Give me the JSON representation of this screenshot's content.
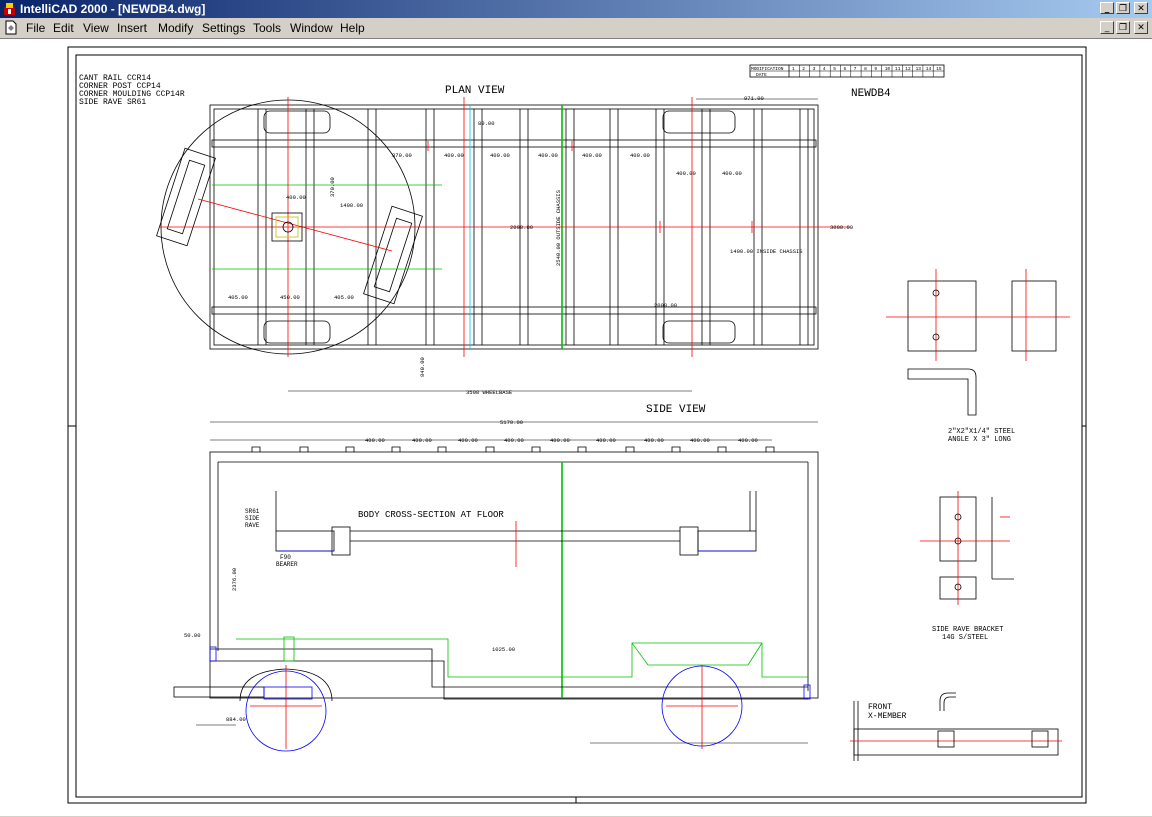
{
  "window": {
    "title": "IntelliCAD 2000 - [NEWDB4.dwg]",
    "controls": {
      "minimize": "_",
      "restore": "❐",
      "close": "✕"
    }
  },
  "menu": {
    "items": [
      {
        "label": "File"
      },
      {
        "label": "Edit"
      },
      {
        "label": "View"
      },
      {
        "label": "Insert"
      },
      {
        "label": "Modify"
      },
      {
        "label": "Settings"
      },
      {
        "label": "Tools"
      },
      {
        "label": "Window"
      },
      {
        "label": "Help"
      }
    ]
  },
  "drawing": {
    "notes": [
      "CANT RAIL CCR14",
      "CORNER POST CCP14",
      "CORNER MOULDING CCP14R",
      "SIDE RAVE SR61"
    ],
    "plan_title": "PLAN VIEW",
    "side_title": "SIDE VIEW",
    "drawing_name": "NEWDB4",
    "cross_section": "BODY CROSS-SECTION AT FLOOR",
    "wheelbase": "3508 WHEELBASE",
    "overall_length": "5170.00",
    "dim_971": "971.00",
    "dim_80": "80.00",
    "dim_3000": "3000.00",
    "dim_2000": "2000.00",
    "dim_1400_plan": "1400.00",
    "dim_1400_inside": "1400.00 INSIDE CHASSIS",
    "dim_2540": "2540.00 OUTSIDE CHASSIS",
    "dim_400": "400.00",
    "dim_370": "370.00",
    "dim_405": "405.00",
    "dim_450": "450.00",
    "dim_840": "840.00",
    "dim_50": "50.00",
    "dim_1025": "1025.00",
    "dim_884": "884.00",
    "dim_2376": "2376.00",
    "sr61": [
      "SR61",
      "SIDE",
      "RAVE"
    ],
    "f90": [
      "F90",
      "BEARER"
    ],
    "steel_angle": [
      "2\"X2\"X1/4\" STEEL",
      "ANGLE X 3\" LONG"
    ],
    "bracket": [
      "SIDE RAVE BRACKET",
      "14G S/STEEL"
    ],
    "front": [
      "FRONT",
      "X-MEMBER"
    ],
    "mod_label": "MODIFICATION",
    "mod_date": "DATE",
    "mod_numbers": [
      "1",
      "2",
      "3",
      "4",
      "5",
      "6",
      "7",
      "8",
      "9",
      "10",
      "11",
      "12",
      "13",
      "14",
      "15"
    ]
  },
  "colors": {
    "title_left": "#0a246a",
    "title_right": "#a6caf0",
    "cad_red": "#ff0000",
    "cad_green": "#00c000",
    "cad_blue": "#0000ff",
    "cad_cyan": "#00c0ff"
  },
  "icons": {
    "app": "intellicad-app-icon",
    "document": "drawing-document-icon"
  }
}
